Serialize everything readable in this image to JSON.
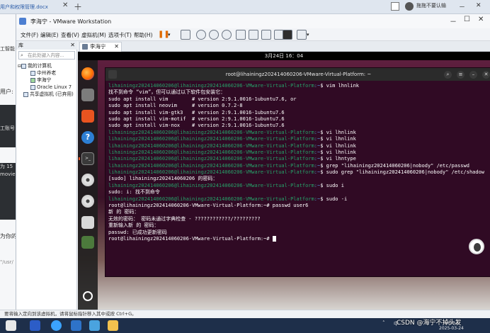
{
  "host": {
    "doc_tab": "用户和权限管理.docx",
    "tray_text": "拖拖不要认输",
    "left_sliver_texts": [
      "工智能",
      "用户:",
      "工账号",
      "为 15",
      "movie",
      "为你的",
      "\"/usr/"
    ],
    "status_text": "要将输入定向到该虚拟机，请将鼠标指针移入其中或按 Ctrl+G。",
    "csdn_watermark": "CSDN @海宁不掉头发",
    "clock_time": "16:04",
    "clock_date": "2025-03-24",
    "input_method": "中"
  },
  "vmware": {
    "title": "李海宁 - VMware Workstation",
    "menu": [
      "文件(F)",
      "编辑(E)",
      "查看(V)",
      "虚拟机(M)",
      "选项卡(T)",
      "帮助(H)"
    ],
    "library": {
      "header": "库",
      "search_placeholder": "在此处键入内容...",
      "tree": [
        {
          "label": "我的计算机",
          "level": 0
        },
        {
          "label": "中州养老",
          "level": 1
        },
        {
          "label": "李海宁",
          "level": 1
        },
        {
          "label": "Oracle Linux 7",
          "level": 1
        },
        {
          "label": "共享虚拟机 (已弃用)",
          "level": 0
        }
      ]
    },
    "vm_tab": "李海宁"
  },
  "guest": {
    "clock": "3月24日  16：04",
    "terminal_title": "root@lihainingz202414060206-VMware-Virtual-Platform: ~",
    "lines": [
      {
        "p": "lihainingz202414060206@lihainingz202414060206-VMware-Virtual-Platform",
        "d": ":~",
        "c": "$ vim lhnlink"
      },
      {
        "t": "找不到命令 “vim”，但可以通过以下软件包安装它："
      },
      {
        "t": "sudo apt install vim        # version 2:9.1.0016-1ubuntu7.6, or"
      },
      {
        "t": "sudo apt install neovim     # version 0.7.2-8"
      },
      {
        "t": "sudo apt install vim-gtk3   # version 2:9.1.0016-1ubuntu7.6"
      },
      {
        "t": "sudo apt install vim-motif  # version 2:9.1.0016-1ubuntu7.6"
      },
      {
        "t": "sudo apt install vim-nox    # version 2:9.1.0016-1ubuntu7.6"
      },
      {
        "p": "lihainingz202414060206@lihainingz202414060206-VMware-Virtual-Platform",
        "d": ":~",
        "c": "$ vi lhnlink"
      },
      {
        "p": "lihainingz202414060206@lihainingz202414060206-VMware-Virtual-Platform",
        "d": ":~",
        "c": "$ vi lhnlink"
      },
      {
        "p": "lihainingz202414060206@lihainingz202414060206-VMware-Virtual-Platform",
        "d": ":~",
        "c": "$ vi lhnlink"
      },
      {
        "p": "lihainingz202414060206@lihainingz202414060206-VMware-Virtual-Platform",
        "d": ":~",
        "c": "$ vi lhnlink"
      },
      {
        "p": "lihainingz202414060206@lihainingz202414060206-VMware-Virtual-Platform",
        "d": ":~",
        "c": "$ vi lhntype"
      },
      {
        "p": "lihainingz202414060206@lihainingz202414060206-VMware-Virtual-Platform",
        "d": ":~",
        "c": "$ grep \"lihainingz202414060206|nobody\" /etc/passwd"
      },
      {
        "p": "lihainingz202414060206@lihainingz202414060206-VMware-Virtual-Platform",
        "d": ":~",
        "c": "$ sudo grep \"lihainingz202414060206|nobody\" /etc/shadow"
      },
      {
        "t": "[sudo] lihainingz202414060206 的密码："
      },
      {
        "p": "lihainingz202414060206@lihainingz202414060206-VMware-Virtual-Platform",
        "d": ":~",
        "c": "$ sudo i"
      },
      {
        "t": "sudo: i: 找不到命令"
      },
      {
        "p": "lihainingz202414060206@lihainingz202414060206-VMware-Virtual-Platform",
        "d": ":~",
        "c": "$ sudo -i"
      },
      {
        "t": "root@lihainingz202414060206-VMware-Virtual-Platform:~# passwd user6"
      },
      {
        "t": "新 的 密码："
      },
      {
        "t": "无效的密码： 密码未通过字典检查 - ????????????/?????????"
      },
      {
        "t": "重新输入新 的 密码："
      },
      {
        "t": "passwd: 已成功更新密码"
      },
      {
        "t": "root@lihainingz202414060206-VMware-Virtual-Platform:~# ",
        "cursor": true
      }
    ]
  },
  "colors": {
    "terminal_bg": "#300a24",
    "prompt_green": "#26a269",
    "prompt_blue": "#5a8fd8",
    "accent_orange": "#e95420"
  }
}
